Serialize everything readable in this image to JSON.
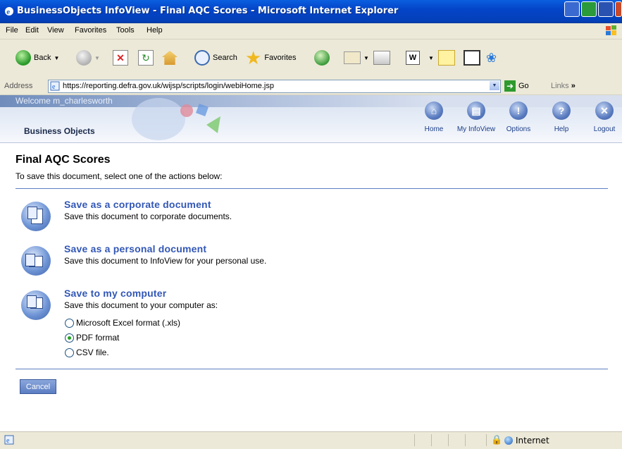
{
  "window": {
    "title": "BusinessObjects InfoView - Final AQC Scores - Microsoft Internet Explorer"
  },
  "menu": {
    "items": [
      "File",
      "Edit",
      "View",
      "Favorites",
      "Tools",
      "Help"
    ]
  },
  "toolbar": {
    "back_label": "Back",
    "search_label": "Search",
    "favorites_label": "Favorites"
  },
  "address": {
    "label": "Address",
    "url": "https://reporting.defra.gov.uk/wijsp/scripts/login/webiHome.jsp",
    "go_label": "Go",
    "links_label": "Links"
  },
  "header": {
    "welcome": "Welcome m_charlesworth",
    "logo": "Business Objects",
    "nav": [
      {
        "label": "Home",
        "icon": "home-icon"
      },
      {
        "label": "My InfoView",
        "icon": "infoview-icon"
      },
      {
        "label": "Options",
        "icon": "options-icon"
      },
      {
        "label": "Help",
        "icon": "help-icon"
      },
      {
        "label": "Logout",
        "icon": "logout-icon"
      }
    ]
  },
  "content": {
    "title": "Final AQC Scores",
    "intro": "To save this document, select one of the actions below:",
    "actions": [
      {
        "title": "Save as a corporate document",
        "desc": "Save this document to corporate documents."
      },
      {
        "title": "Save as a personal document",
        "desc": "Save this document to InfoView for your personal use."
      },
      {
        "title": "Save to my computer",
        "desc": "Save this document to your computer as:"
      }
    ],
    "formats": [
      {
        "label": "Microsoft Excel format (.xls)",
        "selected": false
      },
      {
        "label": "PDF format",
        "selected": true
      },
      {
        "label": "CSV file.",
        "selected": false
      }
    ],
    "cancel_label": "Cancel"
  },
  "status": {
    "zone": "Internet"
  },
  "colors": {
    "titlebar": "#0444c8",
    "chrome": "#ece9d8",
    "link_blue": "#3257b5",
    "accent_line": "#5d7fc4"
  }
}
